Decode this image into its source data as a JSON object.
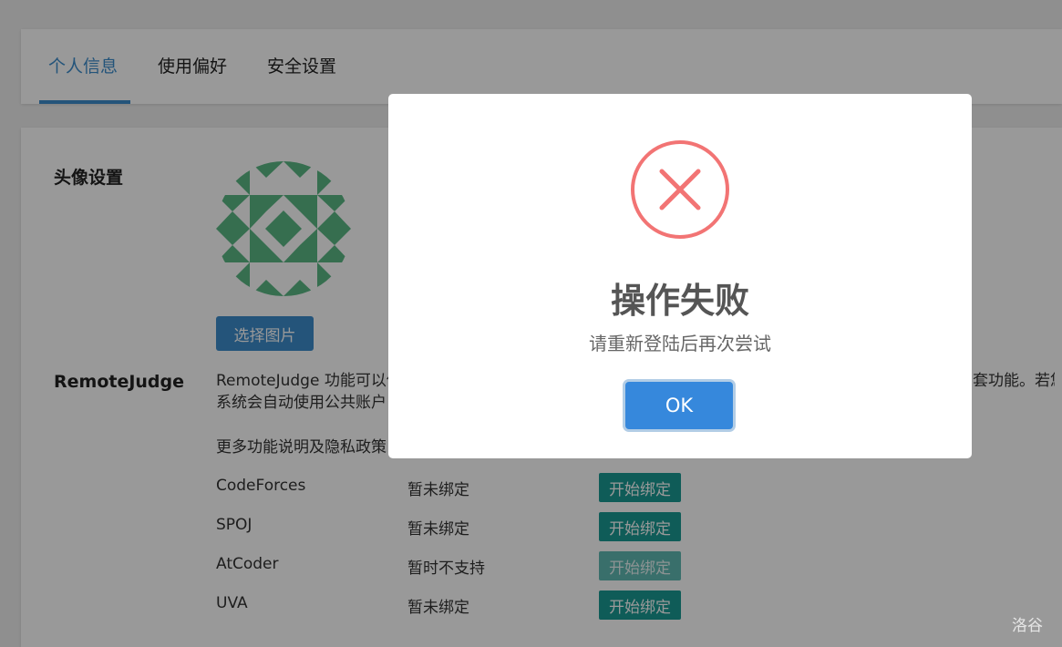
{
  "tabs": [
    {
      "label": "个人信息",
      "active": true
    },
    {
      "label": "使用偏好",
      "active": false
    },
    {
      "label": "安全设置",
      "active": false
    }
  ],
  "avatar_section": {
    "label": "头像设置",
    "choose_button": "选择图片",
    "avatar_color": "#5bb884"
  },
  "remote_judge": {
    "label": "RemoteJudge",
    "description_line1": "RemoteJudge 功能可以使",
    "description_line1_end": "套功能。若您",
    "description_line2": "系统会自动使用公共账户",
    "more_info": "更多功能说明及隐私政策",
    "accounts": [
      {
        "name": "CodeForces",
        "status": "暂未绑定",
        "action": "开始绑定",
        "enabled": true
      },
      {
        "name": "SPOJ",
        "status": "暂未绑定",
        "action": "开始绑定",
        "enabled": true
      },
      {
        "name": "AtCoder",
        "status": "暂时不支持",
        "action": "开始绑定",
        "enabled": false
      },
      {
        "name": "UVA",
        "status": "暂未绑定",
        "action": "开始绑定",
        "enabled": true
      }
    ]
  },
  "modal": {
    "title": "操作失败",
    "message": "请重新登陆后再次尝试",
    "ok_button": "OK",
    "icon": "error-x-icon",
    "icon_color": "#f27474"
  },
  "watermark": "洛谷",
  "colors": {
    "accent": "#3c8ccc",
    "bind_button": "#1a9a93",
    "ok_button": "#3688dc"
  }
}
